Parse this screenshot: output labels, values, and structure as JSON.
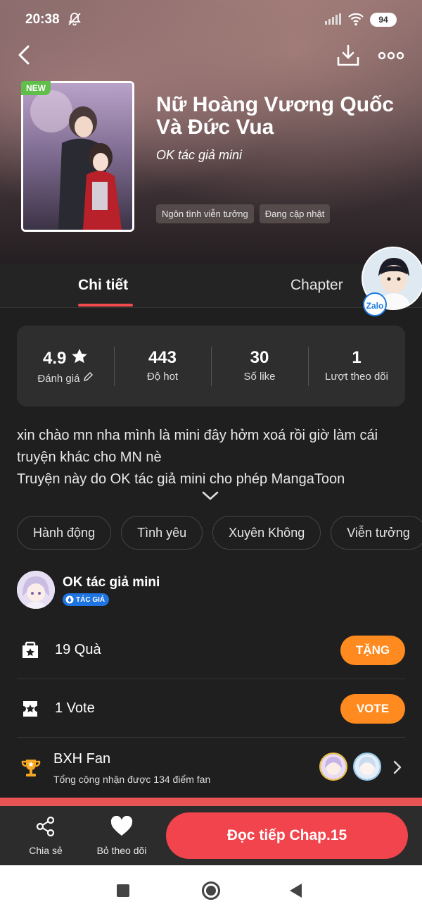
{
  "status_bar": {
    "time": "20:38",
    "battery": "94"
  },
  "book": {
    "badge": "NEW",
    "title_line1": "Nữ Hoàng Vương Quốc",
    "title_line2": "Và Đức Vua",
    "author": "OK tác giả mini",
    "hero_tags": [
      "Ngôn tình viễn tưởng",
      "Đang cập nhật"
    ]
  },
  "tabs": {
    "detail": "Chi tiết",
    "chapter": "Chapter"
  },
  "zalo_label": "Zalo",
  "stats": [
    {
      "value": "4.9",
      "label": "Đánh giá"
    },
    {
      "value": "443",
      "label": "Độ hot"
    },
    {
      "value": "30",
      "label": "Số like"
    },
    {
      "value": "1",
      "label": "Lượt theo dõi"
    }
  ],
  "description": {
    "line1": "xin chào mn nha mình là mini đây hởm xoá rồi giờ làm cái",
    "line2": "truyện khác cho MN nè",
    "line3": "Truyện này do OK tác giả mini cho phép MangaToon"
  },
  "genres": [
    "Hành động",
    "Tình yêu",
    "Xuyên Không",
    "Viễn tưởng"
  ],
  "author_row": {
    "name": "OK tác giả mini",
    "role": "TÁC GIẢ"
  },
  "gift": {
    "label": "19 Quà",
    "button": "TẶNG"
  },
  "vote": {
    "label": "1 Vote",
    "button": "VOTE"
  },
  "fan": {
    "title": "BXH Fan",
    "subtitle": "Tổng cộng nhận được 134 điểm fan"
  },
  "bottom": {
    "share": "Chia sẻ",
    "unfollow": "Bỏ theo dõi",
    "read": "Đọc tiếp Chap.15"
  },
  "colors": {
    "accent_red": "#f2444c",
    "orange": "#ff8a1f",
    "zalo_blue": "#1e7ae0",
    "new_green": "#5fbf4a"
  }
}
